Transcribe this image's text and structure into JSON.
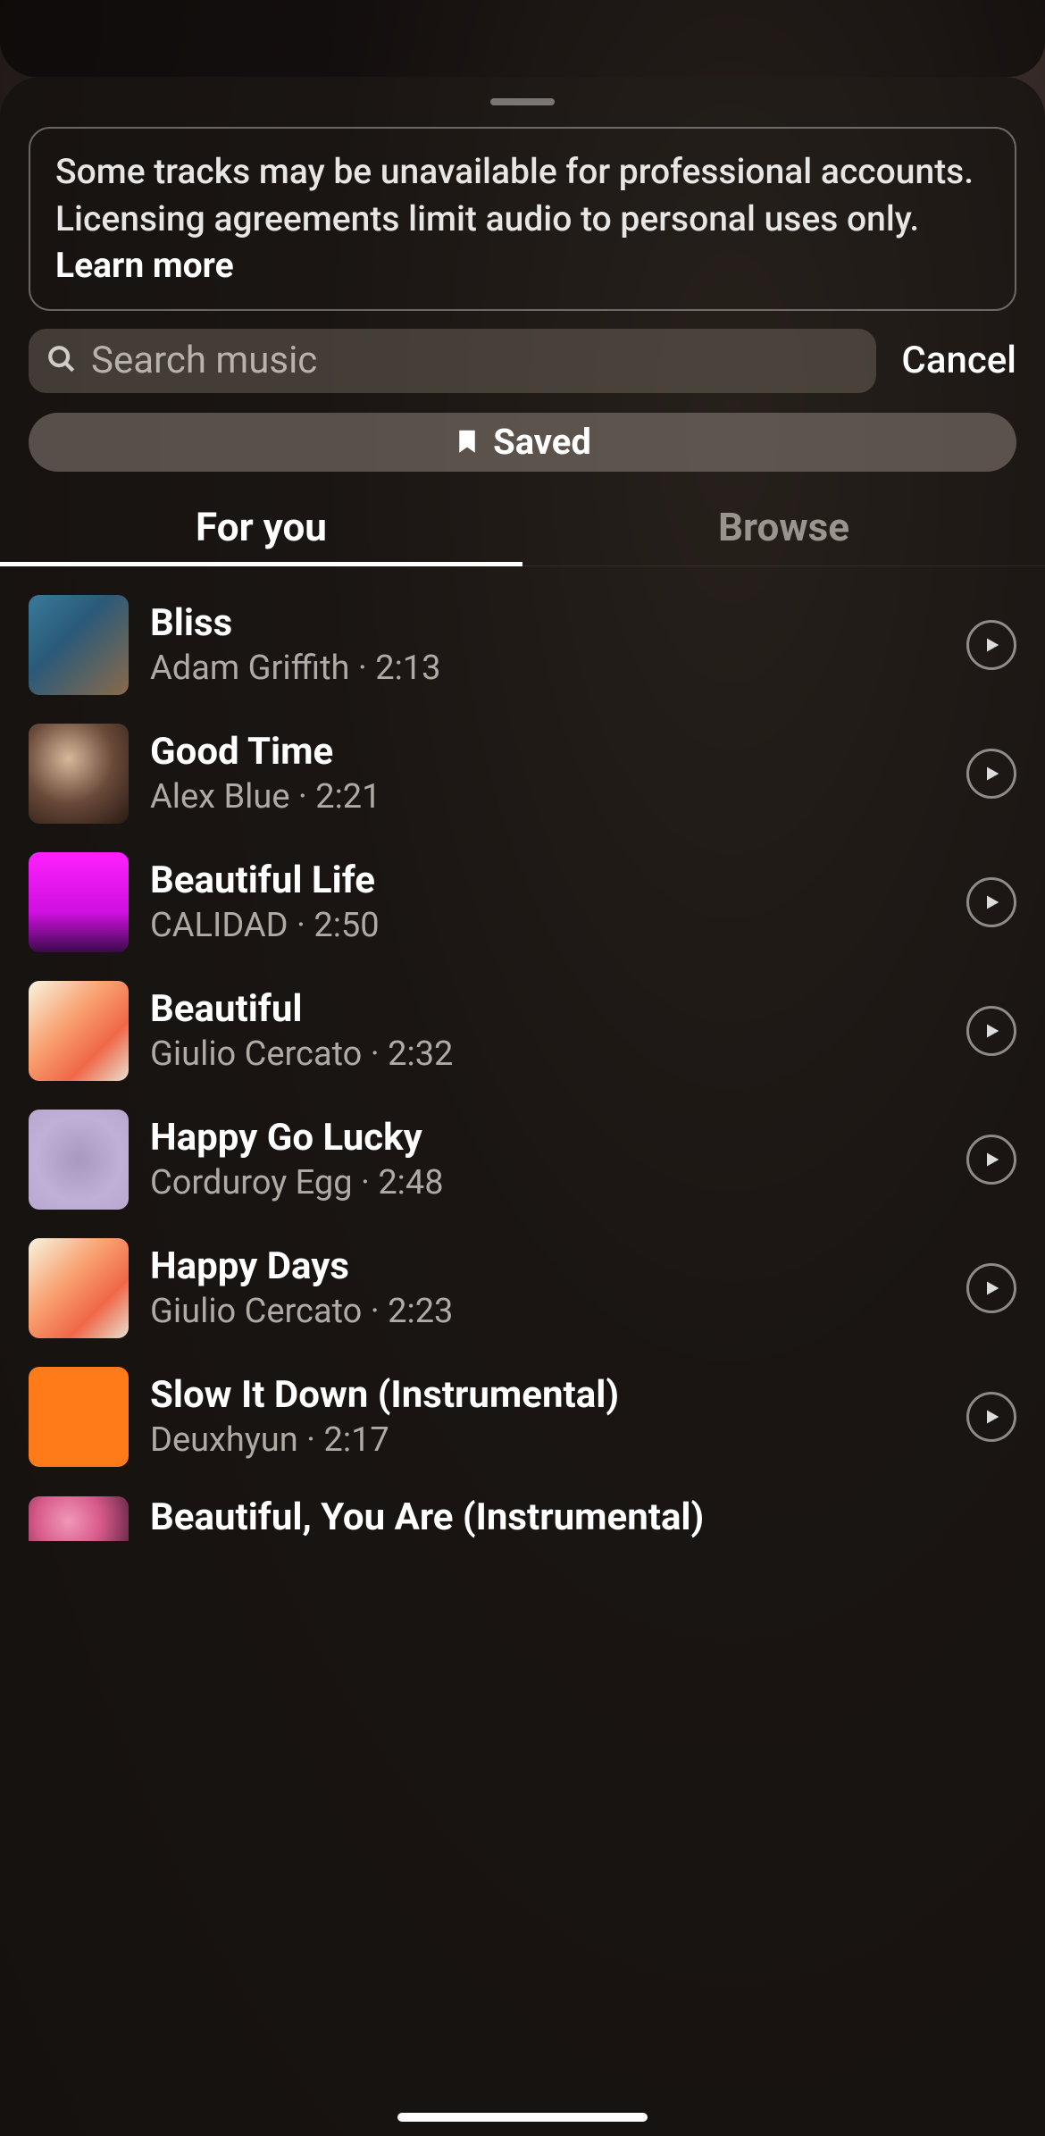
{
  "notice": {
    "text_part1": "Some tracks may be unavailable for professional accounts. Licensing agreements limit audio to personal uses only. ",
    "link_label": "Learn more"
  },
  "search": {
    "placeholder": "Search music",
    "cancel_label": "Cancel"
  },
  "saved": {
    "label": "Saved"
  },
  "tabs": {
    "for_you": "For you",
    "browse": "Browse",
    "active": "for_you"
  },
  "tracks": [
    {
      "title": "Bliss",
      "artist": "Adam Griffith",
      "duration": "2:13"
    },
    {
      "title": "Good Time",
      "artist": "Alex Blue",
      "duration": "2:21"
    },
    {
      "title": "Beautiful Life",
      "artist": "CALIDAD",
      "duration": "2:50"
    },
    {
      "title": "Beautiful",
      "artist": "Giulio Cercato",
      "duration": "2:32"
    },
    {
      "title": "Happy Go Lucky",
      "artist": "Corduroy Egg",
      "duration": "2:48"
    },
    {
      "title": "Happy Days",
      "artist": "Giulio Cercato",
      "duration": "2:23"
    },
    {
      "title": "Slow It Down (Instrumental)",
      "artist": "Deuxhyun",
      "duration": "2:17"
    },
    {
      "title": "Beautiful, You Are (Instrumental)",
      "artist": "",
      "duration": ""
    }
  ],
  "meta_separator": " · "
}
